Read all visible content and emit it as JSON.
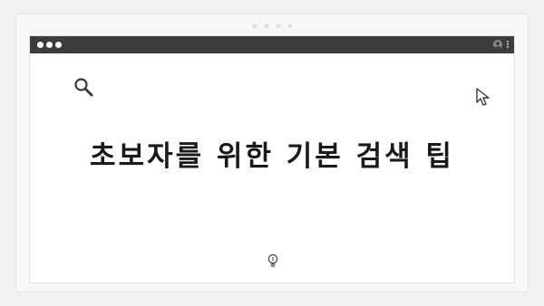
{
  "page": {
    "title": "초보자를 위한 기본 검색 팁"
  },
  "icons": {
    "search": "search-icon",
    "cursor": "cursor-arrow-icon",
    "bulb": "lightbulb-icon",
    "user": "user-account-icon",
    "more": "more-vertical-icon"
  },
  "colors": {
    "title_bar": "#3c3c3e",
    "page_background": "#f0f1f3",
    "title_text": "#1a1a1a"
  }
}
